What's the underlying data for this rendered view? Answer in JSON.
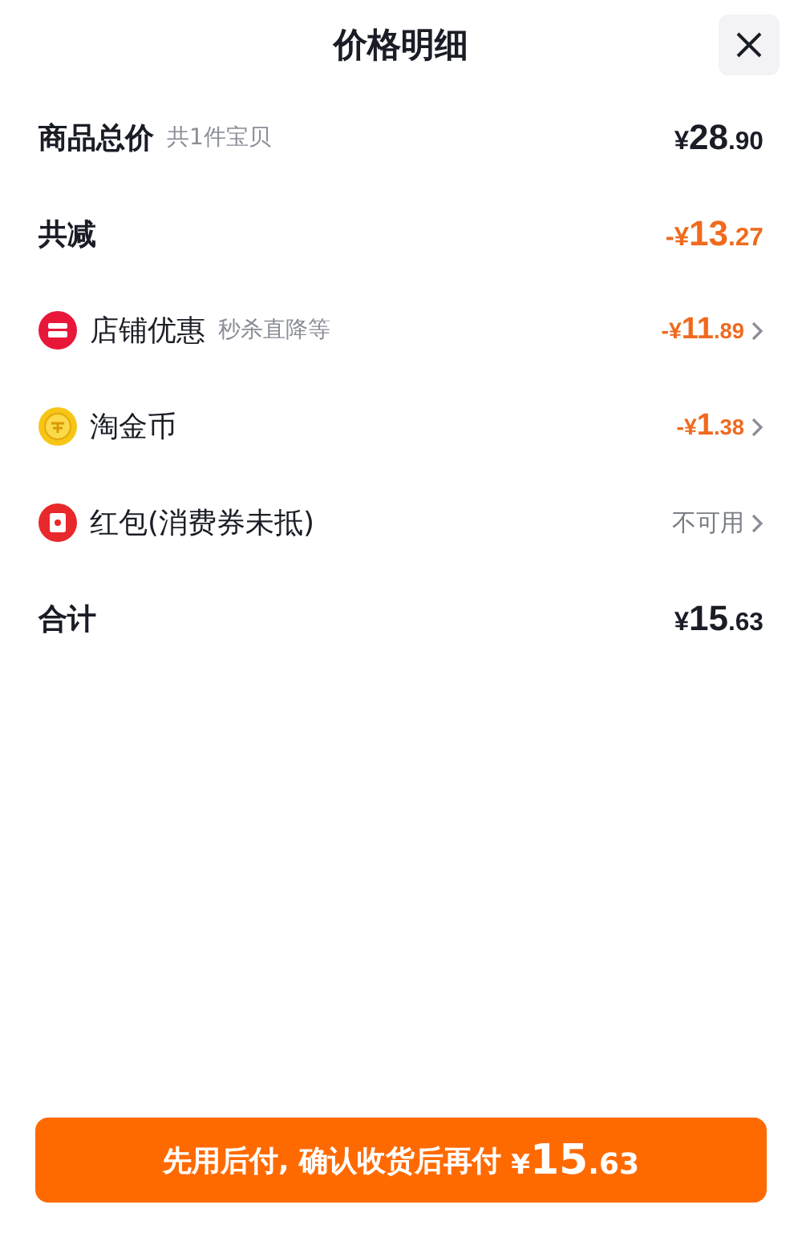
{
  "title": "价格明细",
  "rows": [
    {
      "kind": "summary",
      "label": "商品总价",
      "note": "共1件宝贝",
      "price": {
        "prefix": "¥",
        "main": "28",
        "decimals": ".90"
      },
      "negative": false
    },
    {
      "kind": "summary",
      "label": "共减",
      "price": {
        "prefix": "-¥",
        "main": "13",
        "decimals": ".27"
      },
      "negative": true
    },
    {
      "kind": "shop",
      "label": "店铺优惠",
      "note": "秒杀直降等",
      "price": {
        "prefix": "-¥",
        "main": "11",
        "decimals": ".89"
      },
      "negative": true
    },
    {
      "kind": "coin",
      "label": "淘金币",
      "price": {
        "prefix": "-¥",
        "main": "1",
        "decimals": ".38"
      },
      "negative": true
    },
    {
      "kind": "packet",
      "label": "红包(消费券未抵)",
      "status": "不可用"
    },
    {
      "kind": "summary",
      "label": "合计",
      "price": {
        "prefix": "¥",
        "main": "15",
        "decimals": ".63"
      },
      "negative": false
    }
  ],
  "pay_button": {
    "label": "先用后付, 确认收货后再付",
    "price": {
      "prefix": "¥",
      "main": "15",
      "decimals": ".63"
    }
  }
}
